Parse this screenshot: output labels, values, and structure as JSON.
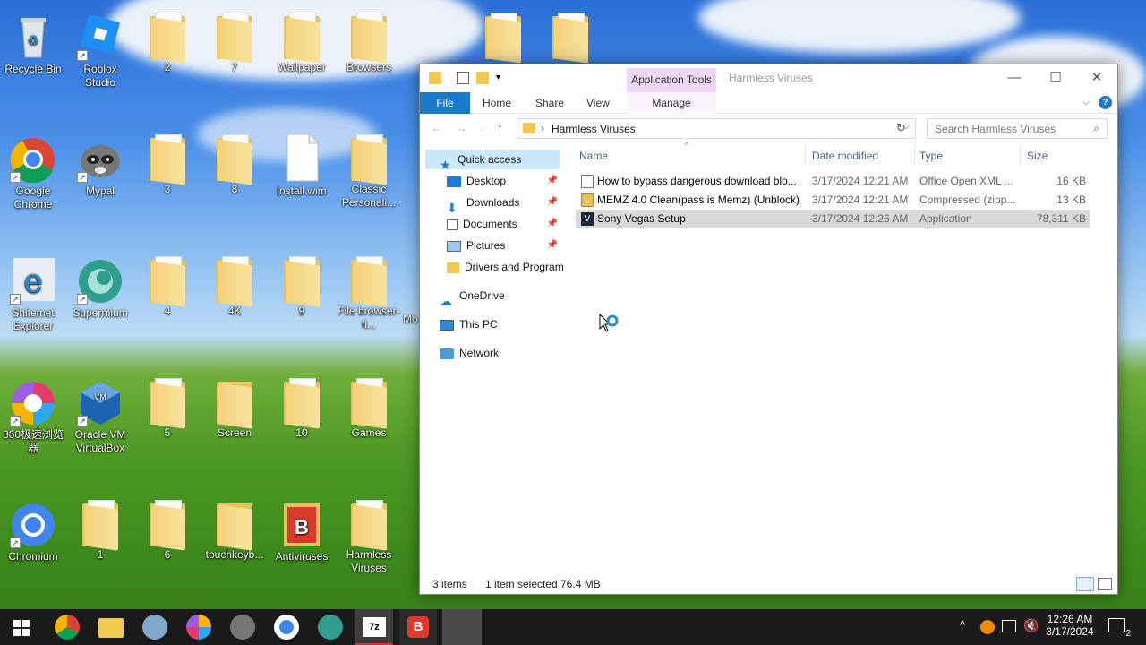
{
  "desktop": {
    "icons": [
      {
        "label": "Recycle Bin"
      },
      {
        "label": "Roblox Studio"
      },
      {
        "label": "2"
      },
      {
        "label": "7"
      },
      {
        "label": "Wallpaper"
      },
      {
        "label": "Browsers"
      },
      {
        "label": "Google Chrome"
      },
      {
        "label": "Mypal"
      },
      {
        "label": "3"
      },
      {
        "label": "8"
      },
      {
        "label": "install.wim"
      },
      {
        "label": "Classic Personali..."
      },
      {
        "label": "Shitemet Explorer"
      },
      {
        "label": "Supermium"
      },
      {
        "label": "4"
      },
      {
        "label": "4K"
      },
      {
        "label": "9"
      },
      {
        "label": "File browser-fi..."
      },
      {
        "label": "360极速浏览器"
      },
      {
        "label": "Oracle VM VirtualBox"
      },
      {
        "label": "5"
      },
      {
        "label": "Screen"
      },
      {
        "label": "10"
      },
      {
        "label": "Games"
      },
      {
        "label": "Chromium"
      },
      {
        "label": "1"
      },
      {
        "label": "6"
      },
      {
        "label": "touchkeyb..."
      },
      {
        "label": "Antiviruses"
      },
      {
        "label": "Harmless Viruses"
      }
    ],
    "partial_label": "Mo"
  },
  "explorer": {
    "title": "Harmless Viruses",
    "contextual_tab_group": "Application Tools",
    "ribbon_tabs": [
      "File",
      "Home",
      "Share",
      "View",
      "Manage"
    ],
    "address_path": "Harmless Viruses",
    "search_placeholder": "Search Harmless Viruses",
    "nav": {
      "quick_access": "Quick access",
      "desktop": "Desktop",
      "downloads": "Downloads",
      "documents": "Documents",
      "pictures": "Pictures",
      "drivers": "Drivers and Program",
      "onedrive": "OneDrive",
      "this_pc": "This PC",
      "network": "Network"
    },
    "columns": {
      "name": "Name",
      "date": "Date modified",
      "type": "Type",
      "size": "Size"
    },
    "files": [
      {
        "name": "How to bypass dangerous download blo...",
        "date": "3/17/2024 12:21 AM",
        "type": "Office Open XML ...",
        "size": "16 KB"
      },
      {
        "name": "MEMZ 4.0 Clean(pass is Memz) (Unblock)",
        "date": "3/17/2024 12:21 AM",
        "type": "Compressed (zipp...",
        "size": "13 KB"
      },
      {
        "name": "Sony Vegas Setup",
        "date": "3/17/2024 12:26 AM",
        "type": "Application",
        "size": "78,311 KB"
      }
    ],
    "status": {
      "items": "3 items",
      "selected": "1 item selected",
      "selected_size": "76.4 MB"
    }
  },
  "taskbar": {
    "time": "12:26 AM",
    "date": "3/17/2024",
    "notification_count": "2"
  }
}
